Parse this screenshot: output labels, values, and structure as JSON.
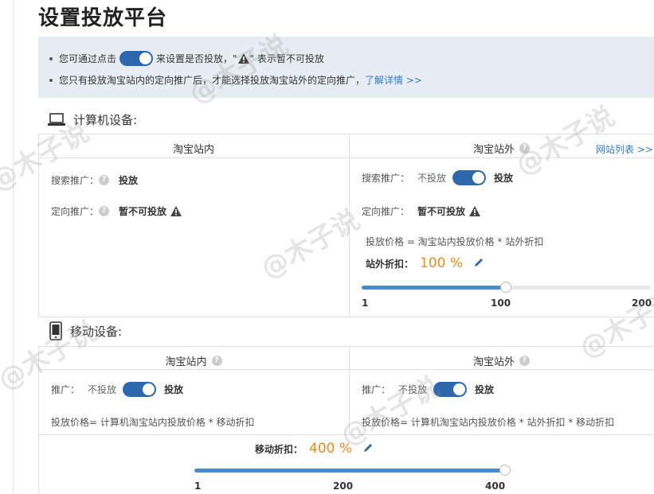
{
  "page": {
    "title": "设置投放平台"
  },
  "notice": {
    "line1_prefix": "您可通过点击",
    "line1_mid": "来设置是否投放，\"",
    "line1_suffix": "\" 表示暂不可投放",
    "line2_text": "您只有投放淘宝站内的定向推广后，才能选择投放淘宝站外的定向推广，",
    "line2_link": "了解详情 >>"
  },
  "pc": {
    "title": "计算机设备:",
    "inside_header": "淘宝站内",
    "outside_header": "淘宝站外",
    "site_list_link": "网站列表 >>",
    "inside": {
      "search_label": "搜索推广：",
      "search_value": "投放",
      "target_label": "定向推广：",
      "target_value": "暂不可投放"
    },
    "outside": {
      "search_label": "搜索推广：",
      "search_off": "不投放",
      "search_on": "投放",
      "target_label": "定向推广：",
      "target_value": "暂不可投放",
      "formula": "投放价格 = 淘宝站内投放价格 * 站外折扣",
      "discount_label": "站外折扣：",
      "discount_value": "100 %",
      "slider": {
        "min": "1",
        "mid": "100",
        "max": "200",
        "value": 100,
        "range_min": 1,
        "range_max": 200
      }
    }
  },
  "mobile": {
    "title": "移动设备:",
    "inside_header": "淘宝站内",
    "outside_header": "淘宝站外",
    "inside": {
      "label": "推广：",
      "off": "不投放",
      "on": "投放",
      "formula": "投放价格= 计算机淘宝站内投放价格 * 移动折扣"
    },
    "outside": {
      "label": "推广：",
      "off": "不投放",
      "on": "投放",
      "formula": "投放价格= 计算机淘宝站内投放价格 * 站外折扣 * 移动折扣"
    },
    "discount_label": "移动折扣：",
    "discount_value": "400 %",
    "slider": {
      "min": "1",
      "mid": "200",
      "max": "400",
      "value": 400,
      "range_min": 1,
      "range_max": 400
    }
  },
  "watermark": {
    "text": "@木子说"
  },
  "colors": {
    "accent": "#2d67ad",
    "orange": "#f08a1c",
    "link": "#2f7bd1",
    "notice_bg": "#e7edf3"
  }
}
